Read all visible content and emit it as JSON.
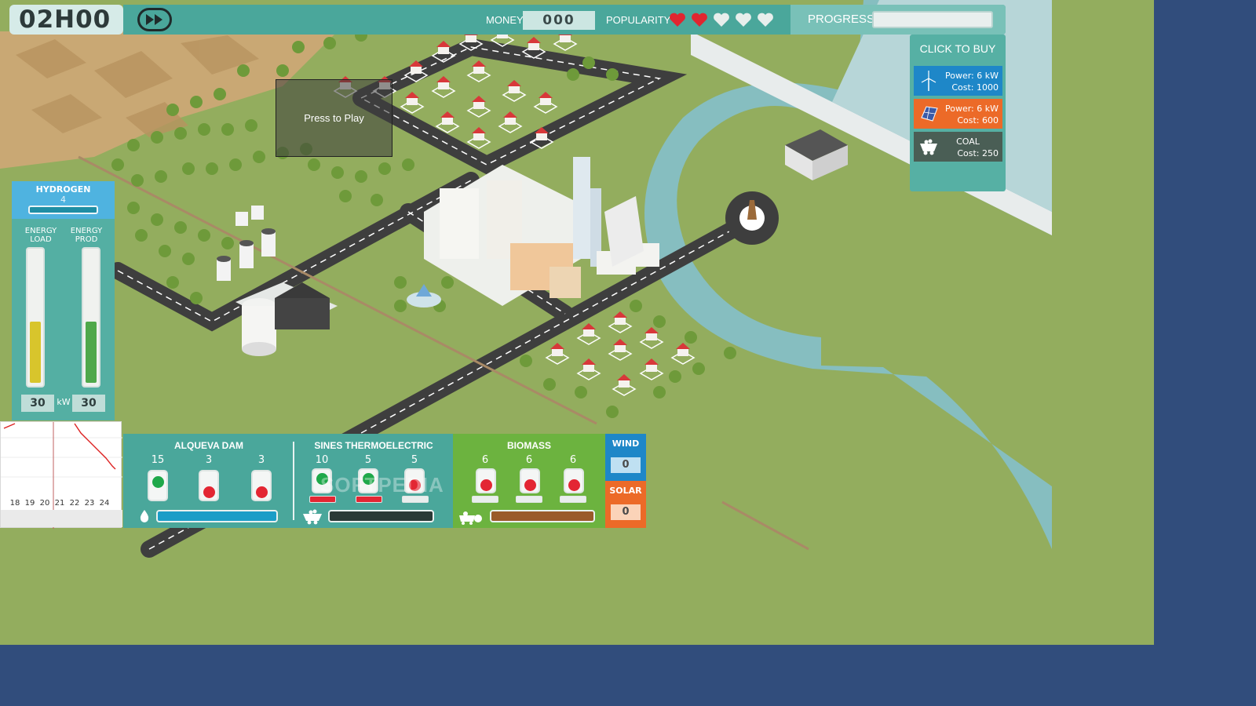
{
  "hud": {
    "time": "02H00",
    "money_label": "MONEY",
    "money_value": "000",
    "popularity_label": "POPULARITY",
    "popularity_filled": 2,
    "popularity_total": 5,
    "progress_label": "PROGRESS",
    "progress_fraction": 0
  },
  "buy_panel": {
    "title": "CLICK TO BUY",
    "items": [
      {
        "icon": "wind-turbine-icon",
        "line1": "Power: 6 kW",
        "line2": "Cost: 1000",
        "color": "#1e87c8"
      },
      {
        "icon": "solar-panel-icon",
        "line1": "Power: 6 kW",
        "line2": "Cost: 600",
        "color": "#ec6a28"
      },
      {
        "icon": "coal-cart-icon",
        "line1": "COAL",
        "line2": "Cost: 250",
        "color": "#4a5e55"
      }
    ]
  },
  "hydrogen": {
    "title": "HYDROGEN",
    "value": "4",
    "load_label_1": "ENERGY",
    "load_label_2": "LOAD",
    "prod_label_1": "ENERGY",
    "prod_label_2": "PROD",
    "load_value": "30",
    "prod_value": "30",
    "unit": "kW",
    "load_fill_fraction": 0.47,
    "prod_fill_fraction": 0.47
  },
  "mini_chart": {
    "ticks": [
      "18",
      "19",
      "20",
      "21",
      "22",
      "23",
      "24"
    ]
  },
  "press_to_play": "Press to Play",
  "watermark": "SOFTPEDIA",
  "plants": {
    "alqueva": {
      "title": "ALQUEVA DAM",
      "units": [
        {
          "num": "15",
          "state": "on"
        },
        {
          "num": "3",
          "state": "off"
        },
        {
          "num": "3",
          "state": "off"
        }
      ],
      "bar_color": "#1a9dc7",
      "icon": "water-drop-icon"
    },
    "sines": {
      "title": "SINES THERMOELECTRIC",
      "units": [
        {
          "num": "10",
          "state": "on"
        },
        {
          "num": "5",
          "state": "on"
        },
        {
          "num": "5",
          "state": "off"
        }
      ],
      "bar_color": "#2a3a36",
      "icon": "coal-cart-icon"
    },
    "biomass": {
      "title": "BIOMASS",
      "units": [
        {
          "num": "6",
          "state": "off"
        },
        {
          "num": "6",
          "state": "off"
        },
        {
          "num": "6",
          "state": "off"
        }
      ],
      "bar_color": "#9a5a2a",
      "icon": "biomass-icon"
    }
  },
  "wind": {
    "title": "WIND",
    "value": "0"
  },
  "solar": {
    "title": "SOLAR",
    "value": "0"
  },
  "colors": {
    "hud_teal": "#4aa79b",
    "heart_red": "#e02530",
    "heart_empty": "#e7eeec",
    "on_green": "#1fa84a",
    "off_red": "#e32633",
    "load_yellow": "#d8c52c",
    "prod_green": "#4fa84a"
  }
}
